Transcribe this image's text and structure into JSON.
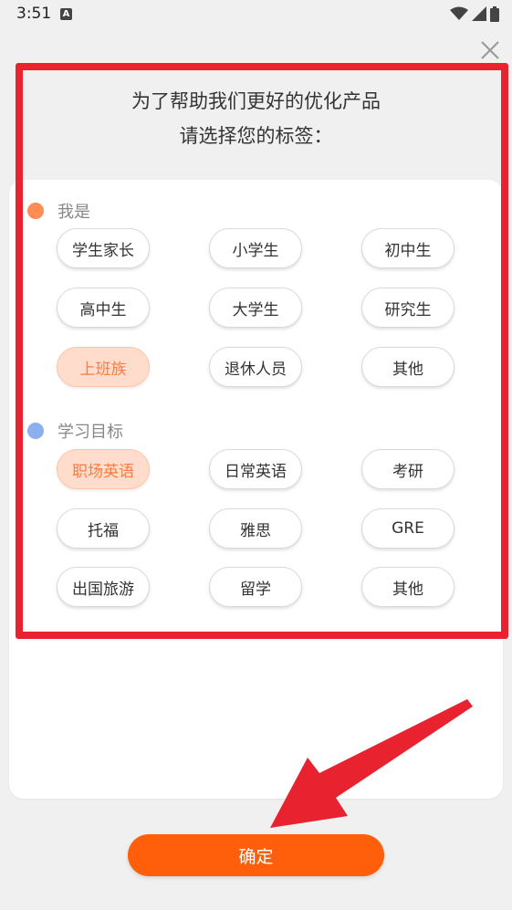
{
  "status_bar": {
    "time": "3:51",
    "notification_letter": "A"
  },
  "header": {
    "line1": "为了帮助我们更好的优化产品",
    "line2": "请选择您的标签："
  },
  "sections": [
    {
      "label": "我是",
      "dot_color": "#ff8c55",
      "tags": [
        {
          "label": "学生家长",
          "selected": false
        },
        {
          "label": "小学生",
          "selected": false
        },
        {
          "label": "初中生",
          "selected": false
        },
        {
          "label": "高中生",
          "selected": false
        },
        {
          "label": "大学生",
          "selected": false
        },
        {
          "label": "研究生",
          "selected": false
        },
        {
          "label": "上班族",
          "selected": true
        },
        {
          "label": "退休人员",
          "selected": false
        },
        {
          "label": "其他",
          "selected": false
        }
      ]
    },
    {
      "label": "学习目标",
      "dot_color": "#8ab0f0",
      "tags": [
        {
          "label": "职场英语",
          "selected": true
        },
        {
          "label": "日常英语",
          "selected": false
        },
        {
          "label": "考研",
          "selected": false
        },
        {
          "label": "托福",
          "selected": false
        },
        {
          "label": "雅思",
          "selected": false
        },
        {
          "label": "GRE",
          "selected": false
        },
        {
          "label": "出国旅游",
          "selected": false
        },
        {
          "label": "留学",
          "selected": false
        },
        {
          "label": "其他",
          "selected": false
        }
      ]
    }
  ],
  "confirm_label": "确定",
  "colors": {
    "accent": "#ff5f0a",
    "selected_bg": "#ffdccc",
    "selected_text": "#ff7a3d",
    "annotation": "#e8222f"
  },
  "icons": [
    "wifi-icon",
    "signal-icon",
    "battery-icon",
    "close-icon"
  ]
}
